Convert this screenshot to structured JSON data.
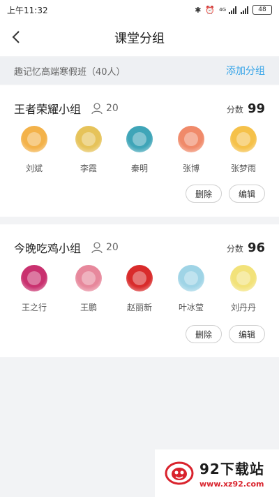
{
  "status_bar": {
    "time": "上午11:32",
    "network": "4G",
    "battery": "48"
  },
  "nav": {
    "title": "课堂分组"
  },
  "class_bar": {
    "class_name": "趣记忆高端寒假班（40人）",
    "add_group_label": "添加分组",
    "accent_color": "#3aa6e8"
  },
  "groups": [
    {
      "name": "王者荣耀小组",
      "member_count": "20",
      "score_label": "分数",
      "score": "99",
      "members": [
        {
          "name": "刘斌",
          "avatar_color": "#f3b24a"
        },
        {
          "name": "李霞",
          "avatar_color": "#e6c35a"
        },
        {
          "name": "秦明",
          "avatar_color": "#3fa5b8"
        },
        {
          "name": "张博",
          "avatar_color": "#f08a6a"
        },
        {
          "name": "张梦雨",
          "avatar_color": "#f5c14a"
        }
      ],
      "delete_label": "删除",
      "edit_label": "编辑"
    },
    {
      "name": "今晚吃鸡小组",
      "member_count": "20",
      "score_label": "分数",
      "score": "96",
      "members": [
        {
          "name": "王之行",
          "avatar_color": "#c9316f"
        },
        {
          "name": "王鹏",
          "avatar_color": "#e7889c"
        },
        {
          "name": "赵丽新",
          "avatar_color": "#d92b2b"
        },
        {
          "name": "叶冰莹",
          "avatar_color": "#9fd4e6"
        },
        {
          "name": "刘丹丹",
          "avatar_color": "#f2e27a"
        }
      ],
      "delete_label": "删除",
      "edit_label": "编辑"
    }
  ],
  "watermark": {
    "title": "92下载站",
    "url": "www.xz92.com"
  }
}
